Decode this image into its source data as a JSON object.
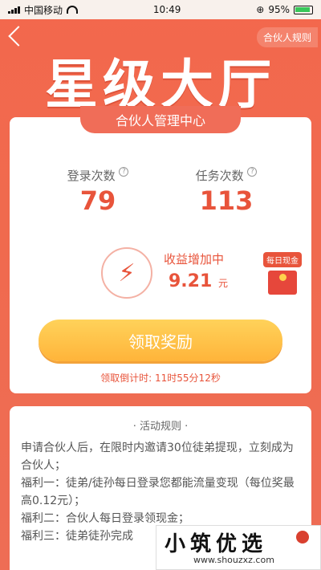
{
  "status_bar": {
    "carrier": "中国移动",
    "time": "10:49",
    "battery": "95%"
  },
  "header": {
    "rules_label": "合伙人规则",
    "hero_title": "星级大厅"
  },
  "card": {
    "tab_title": "合伙人管理中心",
    "login_label": "登录次数",
    "login_value": "79",
    "task_label": "任务次数",
    "task_value": "113",
    "income_title": "收益增加中",
    "income_value": "9.21",
    "income_unit": "元",
    "daily_tag": "每日现金",
    "claim_label": "领取奖励",
    "countdown": "领取倒计时: 11时55分12秒"
  },
  "rules": {
    "title": "· 活动规则 ·",
    "lines": [
      "申请合伙人后，在限时内邀请30位徒弟提现，立刻成为合伙人；",
      "福利一：徒弟/徒孙每日登录您都能流量变现（每位奖最高0.12元）；",
      "福利二：合伙人每日登录领现金；",
      "福利三：徒弟徒孙完成"
    ]
  },
  "watermark": {
    "brand": "小筑优选",
    "url": "www.shouzxz.com"
  },
  "colors": {
    "primary": "#e8543b",
    "background": "#f06a4e",
    "button": "#ffb43a"
  }
}
